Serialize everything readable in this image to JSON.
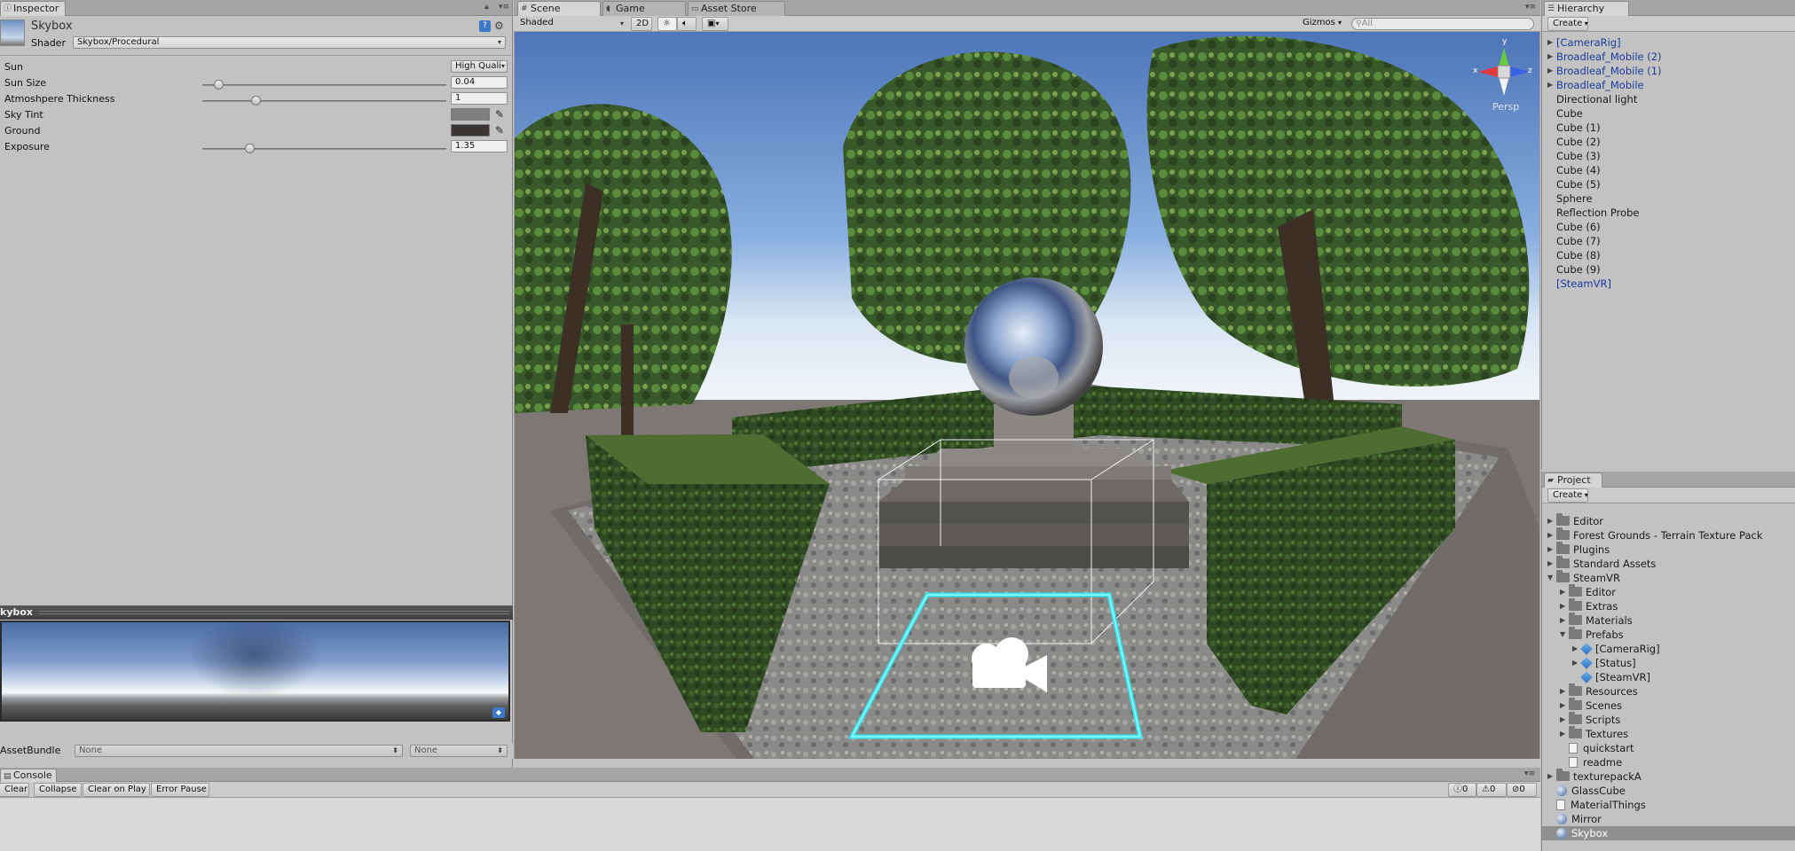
{
  "inspector": {
    "tab": "Inspector",
    "material_name": "Skybox",
    "shader_label": "Shader",
    "shader_value": "Skybox/Procedural",
    "properties": {
      "sun_label": "Sun",
      "sun_value": "High Quali",
      "sun_size_label": "Sun Size",
      "sun_size_value": "0.04",
      "atmosphere_label": "Atmoshpere Thickness",
      "atmosphere_value": "1",
      "sky_tint_label": "Sky Tint",
      "ground_label": "Ground",
      "exposure_label": "Exposure",
      "exposure_value": "1.35"
    },
    "slider_levels": {
      "sun_size": 0.05,
      "atmosphere": 0.21,
      "exposure": 0.18
    },
    "colors": {
      "sky_tint": "#7f7f7f",
      "ground": "#3b3633"
    },
    "preview_title": "kybox",
    "asset_bundle_label": "AssetBundle",
    "asset_bundle_value": "None",
    "asset_variant_value": "None"
  },
  "scene": {
    "tabs": [
      "Scene",
      "Game",
      "Asset Store"
    ],
    "shading_mode": "Shaded",
    "mode_2d": "2D",
    "gizmos_label": "Gizmos",
    "search_placeholder": "All",
    "gizmo": {
      "x": "x",
      "y": "y",
      "z": "z",
      "persp": "Persp"
    }
  },
  "hierarchy": {
    "tab": "Hierarchy",
    "create_label": "Create",
    "items": [
      {
        "label": "[CameraRig]",
        "prefab": true,
        "expandable": true
      },
      {
        "label": "Broadleaf_Mobile (2)",
        "prefab": true,
        "expandable": true
      },
      {
        "label": "Broadleaf_Mobile (1)",
        "prefab": true,
        "expandable": true
      },
      {
        "label": "Broadleaf_Mobile",
        "prefab": true,
        "expandable": true
      },
      {
        "label": "Directional light",
        "prefab": false,
        "expandable": false
      },
      {
        "label": "Cube",
        "prefab": false,
        "expandable": false
      },
      {
        "label": "Cube (1)",
        "prefab": false,
        "expandable": false
      },
      {
        "label": "Cube (2)",
        "prefab": false,
        "expandable": false
      },
      {
        "label": "Cube (3)",
        "prefab": false,
        "expandable": false
      },
      {
        "label": "Cube (4)",
        "prefab": false,
        "expandable": false
      },
      {
        "label": "Cube (5)",
        "prefab": false,
        "expandable": false
      },
      {
        "label": "Sphere",
        "prefab": false,
        "expandable": false
      },
      {
        "label": "Reflection Probe",
        "prefab": false,
        "expandable": false
      },
      {
        "label": "Cube (6)",
        "prefab": false,
        "expandable": false
      },
      {
        "label": "Cube (7)",
        "prefab": false,
        "expandable": false
      },
      {
        "label": "Cube (8)",
        "prefab": false,
        "expandable": false
      },
      {
        "label": "Cube (9)",
        "prefab": false,
        "expandable": false
      },
      {
        "label": "[SteamVR]",
        "prefab": true,
        "expandable": false
      }
    ]
  },
  "project": {
    "tab": "Project",
    "create_label": "Create",
    "items": [
      {
        "label": "Editor",
        "icon": "folder",
        "depth": 0,
        "arrow": "closed"
      },
      {
        "label": "Forest Grounds - Terrain Texture Pack",
        "icon": "folder",
        "depth": 0,
        "arrow": "closed"
      },
      {
        "label": "Plugins",
        "icon": "folder",
        "depth": 0,
        "arrow": "closed"
      },
      {
        "label": "Standard Assets",
        "icon": "folder",
        "depth": 0,
        "arrow": "closed"
      },
      {
        "label": "SteamVR",
        "icon": "folder",
        "depth": 0,
        "arrow": "open"
      },
      {
        "label": "Editor",
        "icon": "folder",
        "depth": 1,
        "arrow": "closed"
      },
      {
        "label": "Extras",
        "icon": "folder",
        "depth": 1,
        "arrow": "closed"
      },
      {
        "label": "Materials",
        "icon": "folder",
        "depth": 1,
        "arrow": "closed"
      },
      {
        "label": "Prefabs",
        "icon": "folder",
        "depth": 1,
        "arrow": "open"
      },
      {
        "label": "[CameraRig]",
        "icon": "prefab",
        "depth": 2,
        "arrow": "closed"
      },
      {
        "label": "[Status]",
        "icon": "prefab",
        "depth": 2,
        "arrow": "closed"
      },
      {
        "label": "[SteamVR]",
        "icon": "prefab",
        "depth": 2,
        "arrow": "none"
      },
      {
        "label": "Resources",
        "icon": "folder",
        "depth": 1,
        "arrow": "closed"
      },
      {
        "label": "Scenes",
        "icon": "folder",
        "depth": 1,
        "arrow": "closed"
      },
      {
        "label": "Scripts",
        "icon": "folder",
        "depth": 1,
        "arrow": "closed"
      },
      {
        "label": "Textures",
        "icon": "folder",
        "depth": 1,
        "arrow": "closed"
      },
      {
        "label": "quickstart",
        "icon": "doc",
        "depth": 1,
        "arrow": "none"
      },
      {
        "label": "readme",
        "icon": "doc",
        "depth": 1,
        "arrow": "none"
      },
      {
        "label": "texturepackA",
        "icon": "folder",
        "depth": 0,
        "arrow": "closed"
      },
      {
        "label": "GlassCube",
        "icon": "material",
        "depth": 0,
        "arrow": "none"
      },
      {
        "label": "MaterialThings",
        "icon": "unity",
        "depth": 0,
        "arrow": "none"
      },
      {
        "label": "Mirror",
        "icon": "material",
        "depth": 0,
        "arrow": "none"
      },
      {
        "label": "Skybox",
        "icon": "material",
        "depth": 0,
        "arrow": "none",
        "selected": true
      }
    ]
  },
  "console": {
    "tab": "Console",
    "buttons": [
      "Clear",
      "Collapse",
      "Clear on Play",
      "Error Pause"
    ],
    "info_count": "0",
    "warning_count": "0",
    "error_count": "0"
  }
}
